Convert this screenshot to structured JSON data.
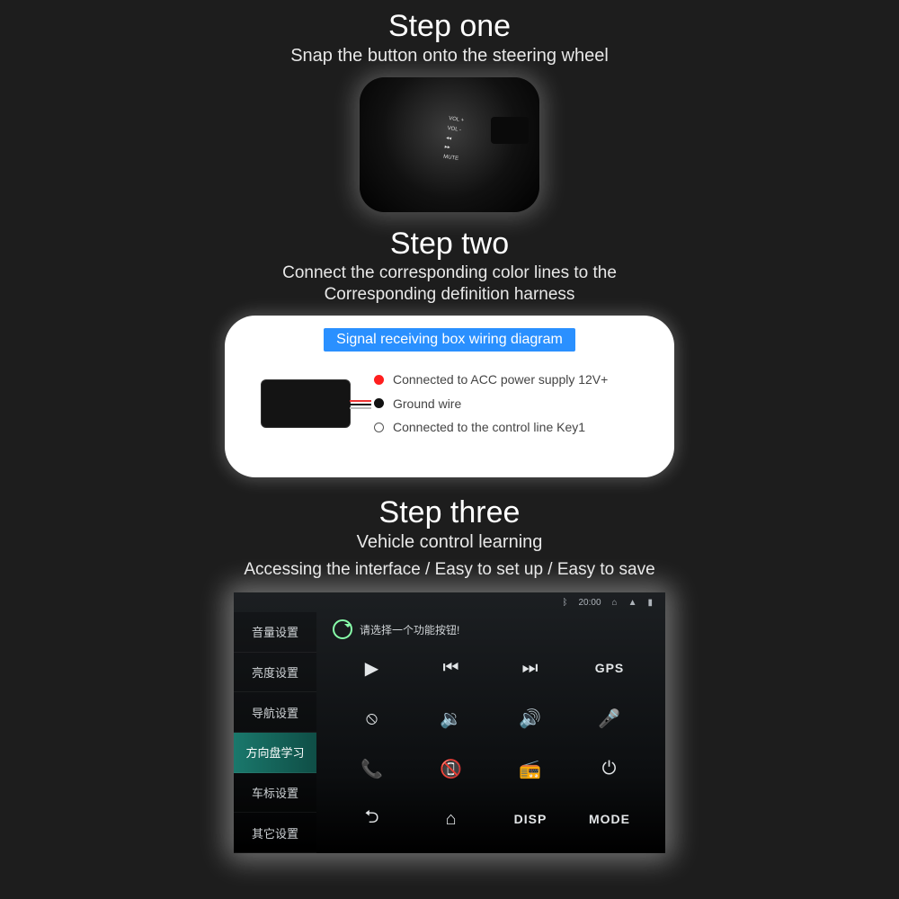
{
  "step1": {
    "title": "Step one",
    "subtitle": "Snap the button onto the steering wheel",
    "wheel_labels": [
      "VOL +",
      "VOL -",
      "◂◂",
      "▸▸",
      "MUTE"
    ]
  },
  "step2": {
    "title": "Step two",
    "subtitle1": "Connect the corresponding color lines to the",
    "subtitle2": "Corresponding definition harness",
    "wiring_header": "Signal receiving box wiring diagram",
    "legend": {
      "red": "Connected to ACC power supply 12V+",
      "black": "Ground wire",
      "open": "Connected to the control line Key1"
    }
  },
  "step3": {
    "title": "Step three",
    "subtitle1": "Vehicle control learning",
    "subtitle2": "Accessing the interface / Easy to set up / Easy to save",
    "status_time": "20:00",
    "side_items": [
      "音量设置",
      "亮度设置",
      "导航设置",
      "方向盘学习",
      "车标设置",
      "其它设置"
    ],
    "active_side_index": 3,
    "top_text": "请选择一个功能按钮!",
    "grid": [
      {
        "type": "ico",
        "glyph": "▶"
      },
      {
        "type": "ico",
        "glyph": "⏮"
      },
      {
        "type": "ico",
        "glyph": "⏭"
      },
      {
        "type": "lbl",
        "glyph": "GPS"
      },
      {
        "type": "ico",
        "glyph": "⦸"
      },
      {
        "type": "ico",
        "glyph": "🔉"
      },
      {
        "type": "ico",
        "glyph": "🔊"
      },
      {
        "type": "ico",
        "glyph": "🎤"
      },
      {
        "type": "ico",
        "glyph": "📞"
      },
      {
        "type": "ico",
        "glyph": "📵"
      },
      {
        "type": "ico",
        "glyph": "📻"
      },
      {
        "type": "ico",
        "glyph": "⏻"
      },
      {
        "type": "ico",
        "glyph": "⮌"
      },
      {
        "type": "ico",
        "glyph": "⌂"
      },
      {
        "type": "lbl",
        "glyph": "DISP"
      },
      {
        "type": "lbl",
        "glyph": "MODE"
      }
    ]
  }
}
